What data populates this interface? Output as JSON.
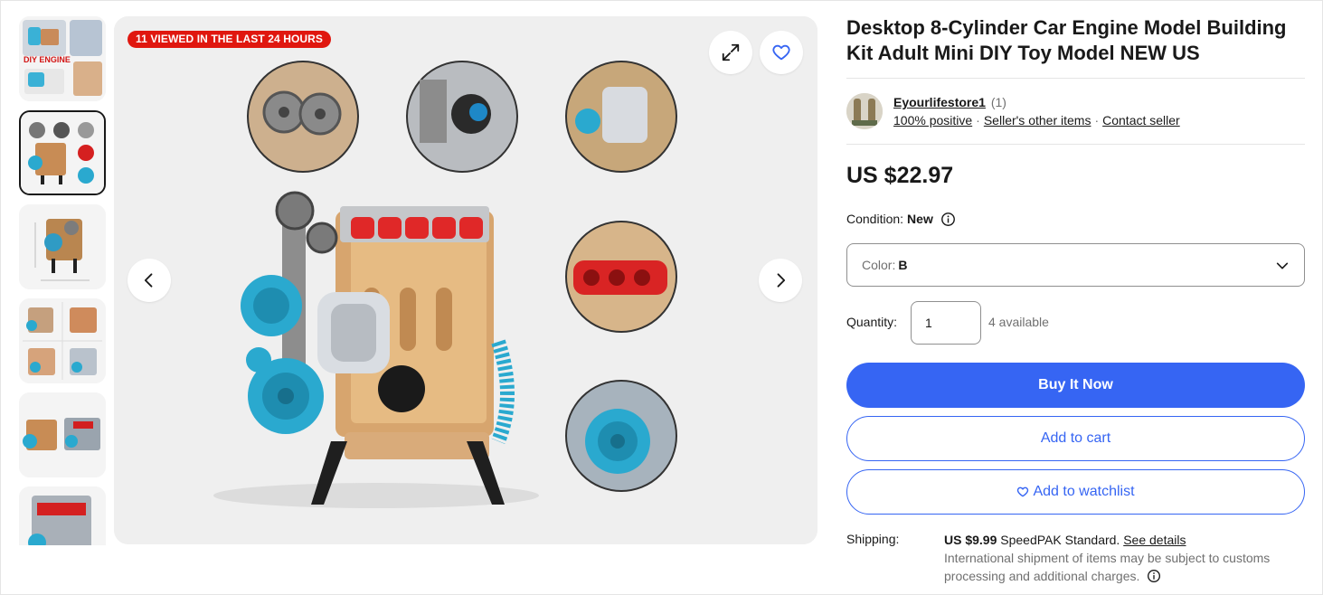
{
  "gallery": {
    "viewed_badge": "11 VIEWED IN THE LAST 24 HOURS",
    "thumbnail_1_text": "DIY ENGINE",
    "thumbnail_count": 6,
    "selected_thumbnail": 2
  },
  "listing": {
    "title": "Desktop 8-Cylinder Car Engine Model Building Kit Adult Mini DIY Toy Model NEW US",
    "price": "US $22.97"
  },
  "seller": {
    "name": "Eyourlifestore1",
    "feedback_count": "(1)",
    "positive": "100% positive",
    "other_items": "Seller's other items",
    "contact": "Contact seller"
  },
  "condition": {
    "label": "Condition:",
    "value": "New"
  },
  "variation": {
    "label": "Color:",
    "value": "B"
  },
  "quantity": {
    "label": "Quantity:",
    "value": "1",
    "available": "4 available"
  },
  "actions": {
    "buy_now": "Buy It Now",
    "add_to_cart": "Add to cart",
    "watchlist": "Add to watchlist"
  },
  "shipping": {
    "label": "Shipping:",
    "price": "US $9.99",
    "service": "SpeedPAK Standard.",
    "details_link": "See details",
    "note": "International shipment of items may be subject to customs processing and additional charges."
  },
  "colors": {
    "primary_button": "#3665f3",
    "badge": "#e0170f",
    "text": "#191919",
    "muted": "#707070"
  },
  "icons": [
    "expand-icon",
    "heart-icon",
    "chevron-left-icon",
    "chevron-right-icon",
    "info-icon",
    "chevron-down-icon"
  ]
}
